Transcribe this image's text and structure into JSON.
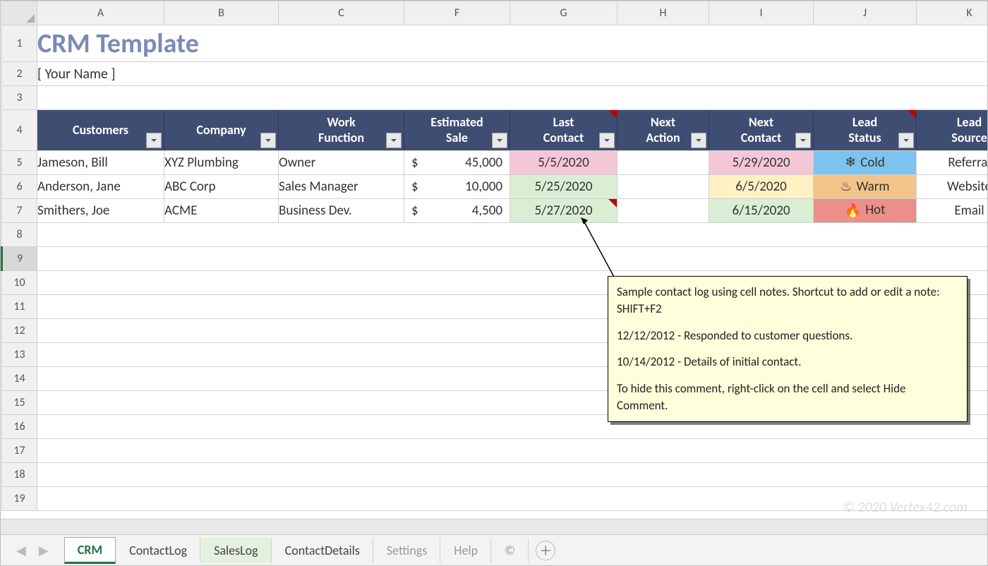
{
  "columns": [
    "A",
    "B",
    "C",
    "F",
    "G",
    "H",
    "I",
    "J",
    "K"
  ],
  "rows": [
    "1",
    "2",
    "3",
    "4",
    "5",
    "6",
    "7",
    "8",
    "9",
    "10",
    "11",
    "12",
    "13",
    "14",
    "15",
    "16",
    "17",
    "18",
    "19"
  ],
  "title": "CRM Template",
  "subtitle": "[ Your Name ]",
  "headers": {
    "customers": "Customers",
    "company": "Company",
    "workFunction1": "Work",
    "workFunction2": "Function",
    "estimated1": "Estimated",
    "estimated2": "Sale",
    "lastContact1": "Last",
    "lastContact2": "Contact",
    "nextAction1": "Next",
    "nextAction2": "Action",
    "nextContact1": "Next",
    "nextContact2": "Contact",
    "leadStatus1": "Lead",
    "leadStatus2": "Status",
    "leadSource1": "Lead",
    "leadSource2": "Source"
  },
  "data": [
    {
      "customer": "Jameson, Bill",
      "company": "XYZ Plumbing",
      "work": "Owner",
      "currency": "$",
      "estimated": "45,000",
      "lastContact": "5/5/2020",
      "lastContactBg": "bg-pink",
      "nextAction": "",
      "nextContact": "5/29/2020",
      "nextContactBg": "bg-pink",
      "leadStatus": "Cold",
      "leadStatusBg": "bg-cold",
      "leadIcon": "snow",
      "leadSource": "Referral"
    },
    {
      "customer": "Anderson, Jane",
      "company": "ABC Corp",
      "work": "Sales Manager",
      "currency": "$",
      "estimated": "10,000",
      "lastContact": "5/25/2020",
      "lastContactBg": "bg-lgreen",
      "nextAction": "",
      "nextContact": "6/5/2020",
      "nextContactBg": "bg-yellow",
      "leadStatus": "Warm",
      "leadStatusBg": "bg-warm",
      "leadIcon": "steam",
      "leadSource": "Website"
    },
    {
      "customer": "Smithers, Joe",
      "company": "ACME",
      "work": "Business Dev.",
      "currency": "$",
      "estimated": "4,500",
      "lastContact": "5/27/2020",
      "lastContactBg": "bg-lgreen",
      "nextAction": "",
      "nextContact": "6/15/2020",
      "nextContactBg": "bg-lgreen",
      "leadStatus": "Hot",
      "leadStatusBg": "bg-hot",
      "leadIcon": "flame",
      "leadSource": "Email"
    }
  ],
  "comment": {
    "p1": "Sample contact log using cell notes. Shortcut to add or edit a note: SHIFT+F2",
    "p2": "12/12/2012 - Responded to customer questions.",
    "p3": "10/14/2012 - Details of initial contact.",
    "p4": "To hide this comment, right-click on the cell and select Hide Comment."
  },
  "watermark": "© 2020 Vertex42.com",
  "tabs": {
    "crm": "CRM",
    "contactLog": "ContactLog",
    "salesLog": "SalesLog",
    "contactDetails": "ContactDetails",
    "settings": "Settings",
    "help": "Help",
    "copyright": "©"
  }
}
